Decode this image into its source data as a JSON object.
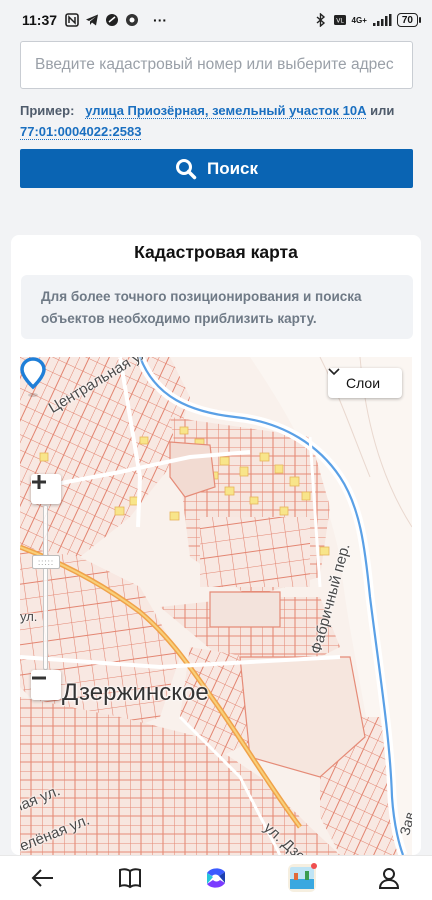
{
  "status_bar": {
    "time": "11:37",
    "network": "4G+",
    "battery": "70",
    "more": "···"
  },
  "search": {
    "placeholder": "Введите кадастровый номер или выберите адрес",
    "example_label": "Пример:",
    "example_address": "улица Приозёрная, земельный участок 10А",
    "example_or": "или",
    "example_number": "77:01:0004022:2583",
    "button_label": "Поиск"
  },
  "map": {
    "title": "Кадастровая карта",
    "notice": "Для более точного позиционирования и поиска объектов необходимо приблизить карту.",
    "layers_label": "Слои",
    "zoom_in_label": "+",
    "zoom_out_label": "−",
    "labels": {
      "central_street": "Центральная ул.",
      "factory_lane": "Фабричный пер.",
      "city": "Дзержинское",
      "green_street_1": "ная ул.",
      "green_street_2": "Зелёная ул.",
      "dzerzhinsky_street": "ул. Дзер",
      "left_fragment": "ул.",
      "right_fragment": "Зав"
    }
  },
  "colors": {
    "primary": "#0a64b3",
    "link": "#1a6fc0",
    "parcel": "#e88c78",
    "river": "#5aa0e6",
    "road": "#f0a24a"
  },
  "bottom_nav": {
    "items": [
      "back-icon",
      "book-icon",
      "app-logo-icon",
      "game-icon",
      "profile-icon"
    ]
  }
}
